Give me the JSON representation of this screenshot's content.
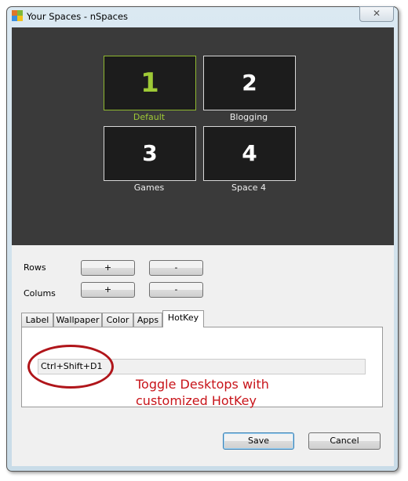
{
  "window": {
    "title": "Your Spaces - nSpaces",
    "close_icon": "✕"
  },
  "spaces": [
    {
      "number": "1",
      "label": "Default",
      "selected": true
    },
    {
      "number": "2",
      "label": "Blogging",
      "selected": false
    },
    {
      "number": "3",
      "label": "Games",
      "selected": false
    },
    {
      "number": "4",
      "label": "Space 4",
      "selected": false
    }
  ],
  "grid": {
    "rows_label": "Rows",
    "columns_label": "Colums",
    "plus": "+",
    "minus": "-"
  },
  "tabs": [
    {
      "label": "Label"
    },
    {
      "label": "Wallpaper"
    },
    {
      "label": "Color"
    },
    {
      "label": "Apps"
    },
    {
      "label": "HotKey",
      "active": true
    }
  ],
  "hotkey": {
    "value": "Ctrl+Shift+D1"
  },
  "annotation": {
    "line1": "Toggle Desktops with",
    "line2": "customized HotKey",
    "color": "#c8141a"
  },
  "footer": {
    "save": "Save",
    "cancel": "Cancel"
  },
  "colors": {
    "selected_accent": "#9ec936",
    "dark_bg": "#3a3a3a"
  }
}
